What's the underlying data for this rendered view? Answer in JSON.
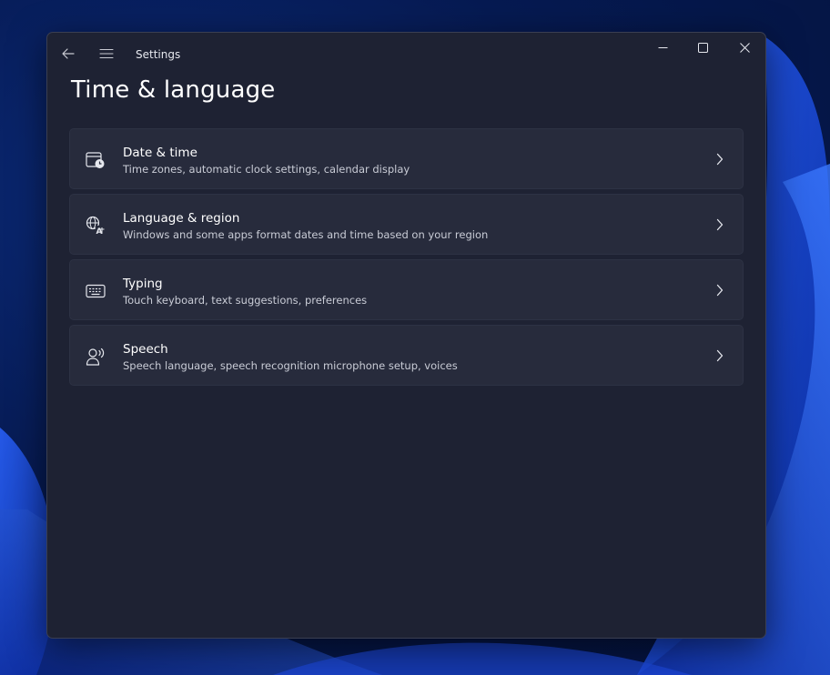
{
  "window": {
    "app_title": "Settings",
    "page_title": "Time & language"
  },
  "icons": {
    "back": "back-arrow-icon",
    "menu": "hamburger-menu-icon",
    "minimize": "minimize-icon",
    "maximize": "maximize-icon",
    "close": "close-icon"
  },
  "items": [
    {
      "title": "Date & time",
      "description": "Time zones, automatic clock settings, calendar display",
      "icon": "calendar-clock-icon"
    },
    {
      "title": "Language & region",
      "description": "Windows and some apps format dates and time based on your region",
      "icon": "language-icon"
    },
    {
      "title": "Typing",
      "description": "Touch keyboard, text suggestions, preferences",
      "icon": "keyboard-icon"
    },
    {
      "title": "Speech",
      "description": "Speech language, speech recognition microphone setup, voices",
      "icon": "speech-icon"
    }
  ],
  "colors": {
    "window_bg": "#1e2233",
    "card_bg": "#272b3c",
    "wallpaper_blue": "#1f4fe0"
  }
}
